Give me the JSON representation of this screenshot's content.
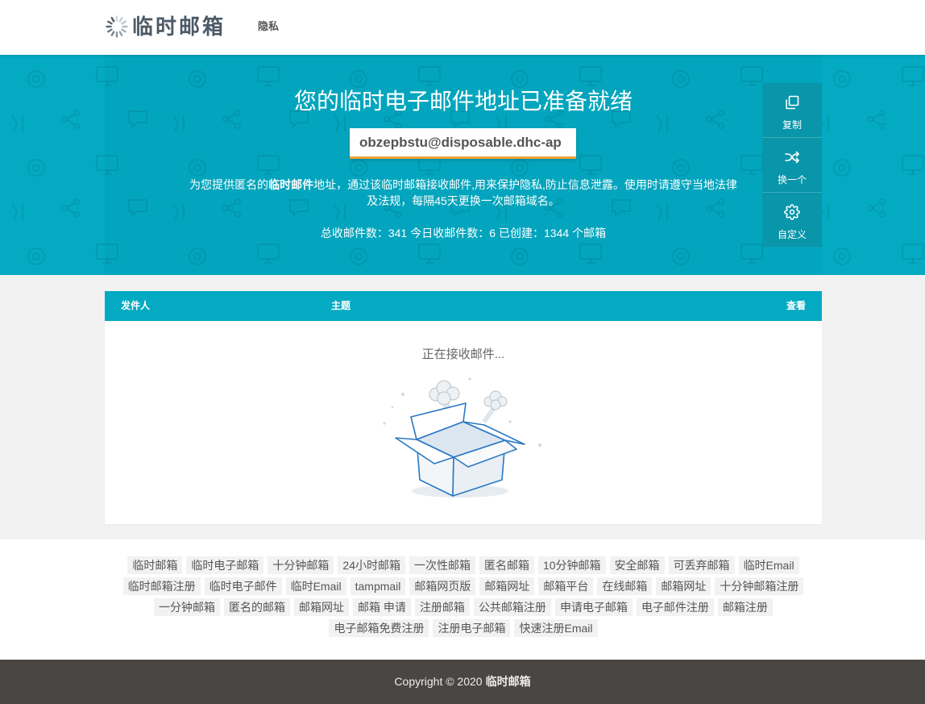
{
  "app": {
    "logo_text": "临时邮箱"
  },
  "nav": {
    "privacy": "隐私"
  },
  "hero": {
    "title": "您的临时电子邮件地址已准备就绪",
    "email_value": "obzepbstu@disposable.dhc-ap",
    "description": {
      "pre": "为您提供匿名的",
      "bold": "临时邮件",
      "post": "地址，通过该临时邮箱接收邮件,用来保护隐私,防止信息泄露。使用时请遵守当地法律",
      "line2": "及法规，每隔45天更换一次邮箱域名。"
    },
    "stats": {
      "total_label": "总收邮件数：",
      "total": "341",
      "today_label": "今日收邮件数：",
      "today": "6",
      "created_label": "已创建：",
      "created": "1344",
      "created_unit": "个邮箱"
    }
  },
  "actions": [
    {
      "label": "复制",
      "icon": "copy-icon"
    },
    {
      "label": "换一个",
      "icon": "shuffle-icon"
    },
    {
      "label": "自定义",
      "icon": "gear-icon"
    }
  ],
  "inbox": {
    "columns": {
      "sender": "发件人",
      "subject": "主题",
      "view": "查看"
    },
    "status": "正在接收邮件..."
  },
  "footer": {
    "tag_rows": [
      [
        "临时邮箱",
        "临时电子邮箱",
        "十分钟邮箱",
        "24小时邮箱",
        "一次性邮箱",
        "匿名邮箱",
        "10分钟邮箱",
        "安全邮箱",
        "可丢弃邮箱",
        "临时Email"
      ],
      [
        "临时邮箱注册",
        "临时电子邮件",
        "临时Email",
        "tampmail",
        "邮箱网页版",
        "邮箱网址",
        "邮箱平台",
        "在线邮箱",
        "邮箱网址",
        "十分钟邮箱注册"
      ],
      [
        "一分钟邮箱",
        "匿名的邮箱",
        "邮箱网址",
        "邮箱 申请",
        "注册邮箱",
        "公共邮箱注册",
        "申请电子邮箱",
        "电子邮件注册",
        "邮箱注册"
      ],
      [
        "电子邮箱免费注册",
        "注册电子邮箱",
        "快速注册Email"
      ]
    ],
    "copyright_prefix": "Copyright © 2020",
    "copyright_brand": "临时邮箱"
  },
  "colors": {
    "primary": "#03aac2",
    "panel": "#0995aa",
    "accent": "#f0a135",
    "footer": "#4a4644"
  }
}
